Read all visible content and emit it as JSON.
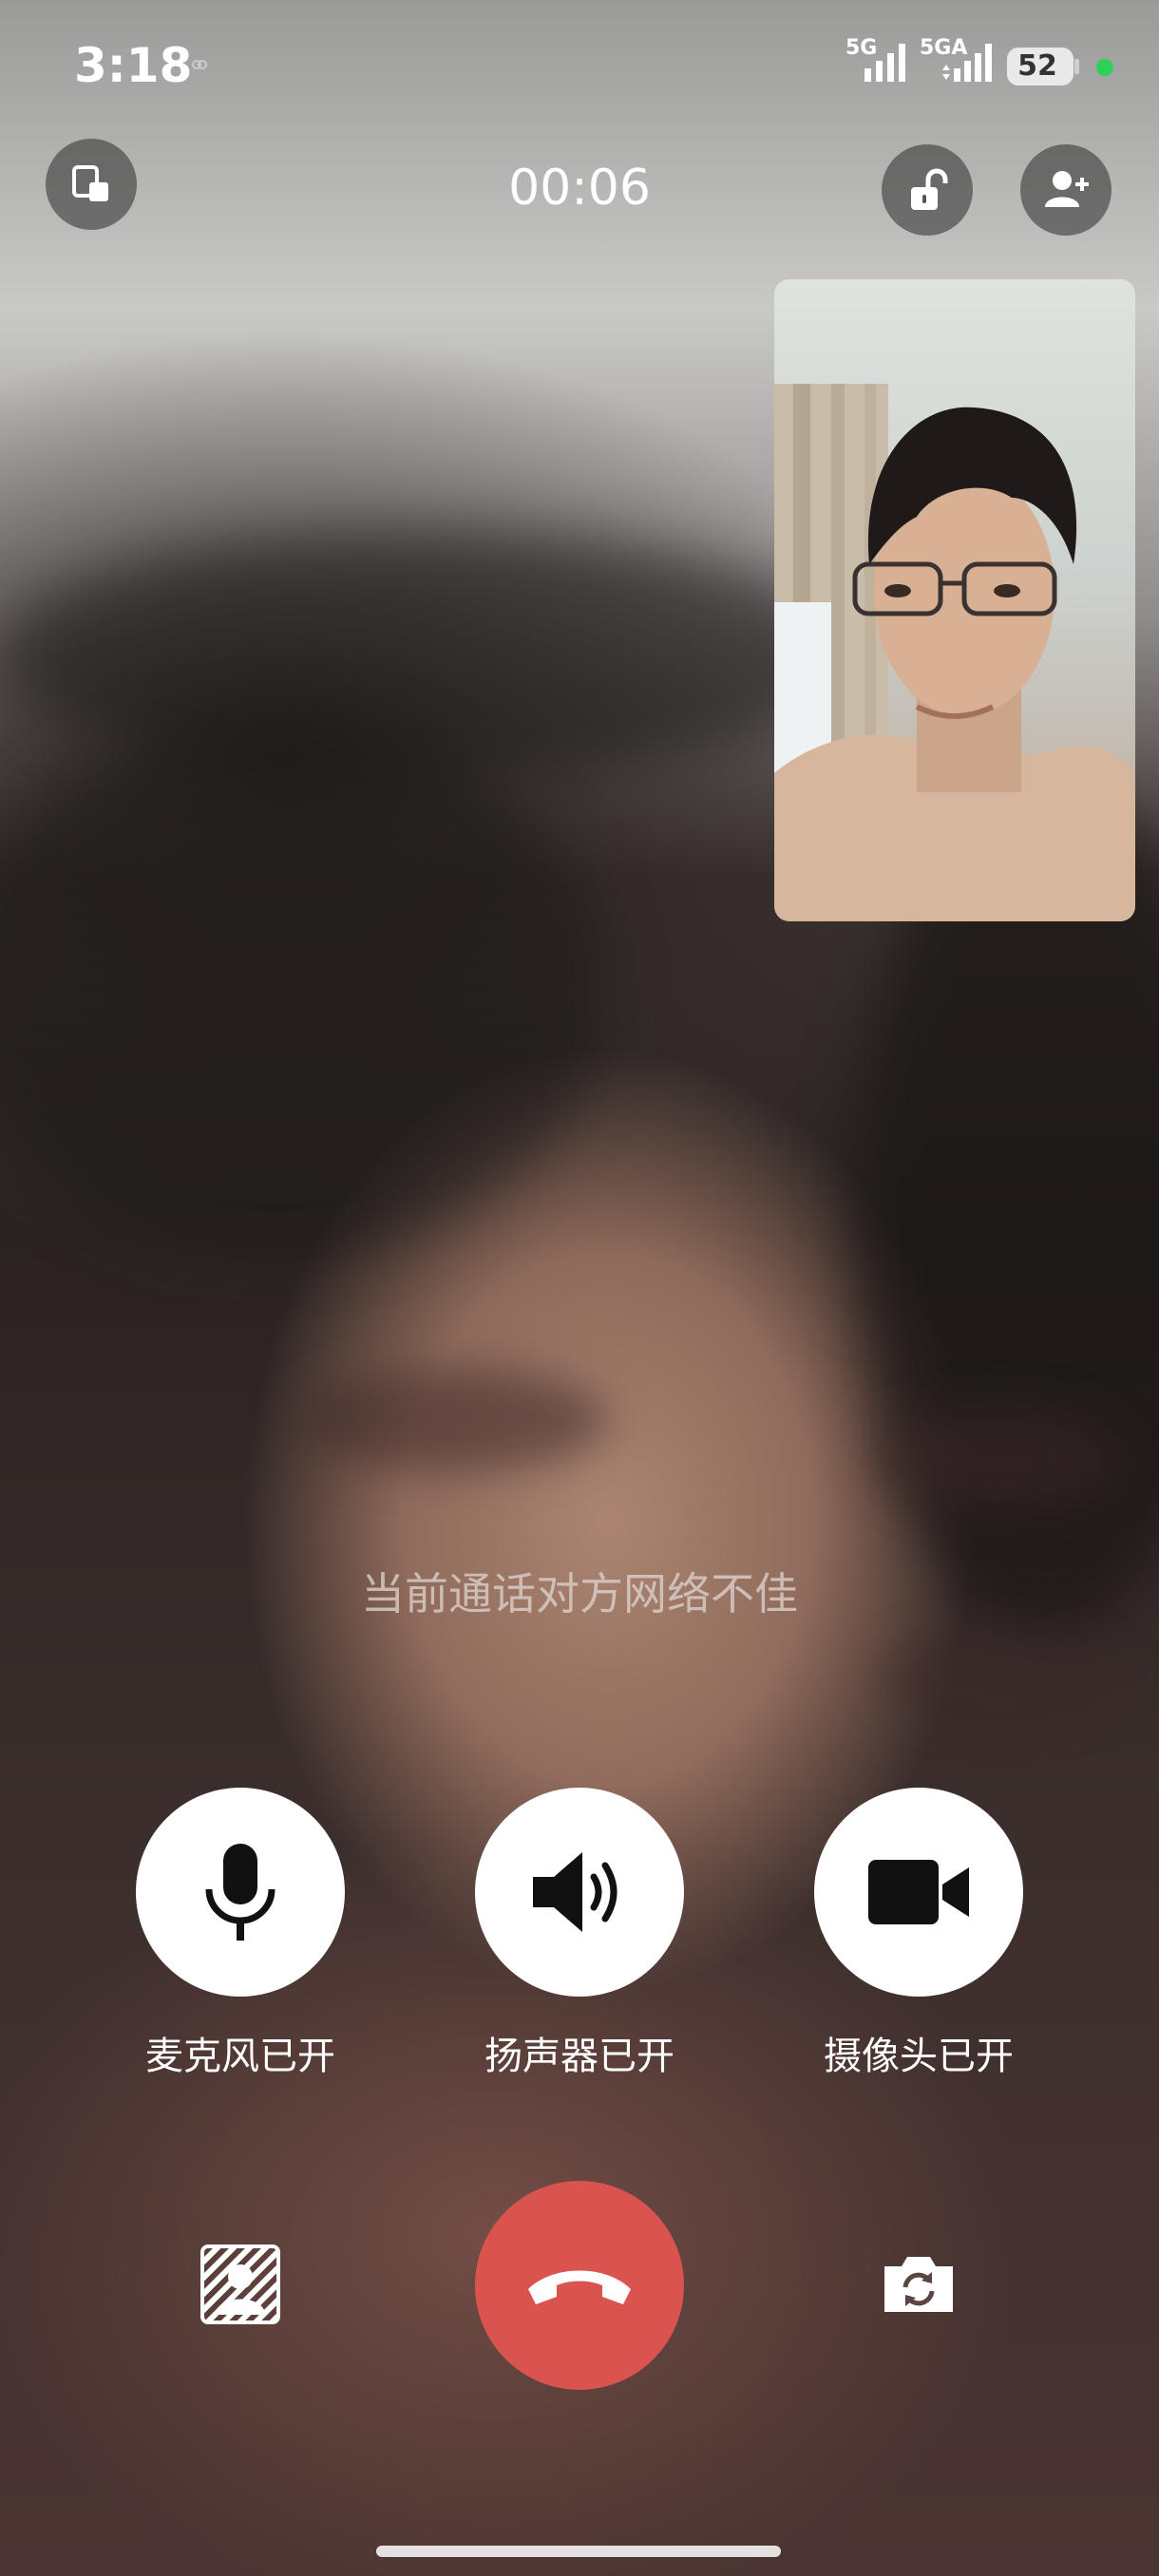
{
  "status_bar": {
    "time": "3:18",
    "signal_1_label": "5G",
    "signal_2_label": "5GA",
    "battery": "52",
    "dot_color": "#2ed158"
  },
  "header": {
    "duration": "00:06",
    "left_icon": "minimize-window-icon",
    "lock_icon": "unlock-icon",
    "add_icon": "add-person-icon"
  },
  "notice": "当前通话对方网络不佳",
  "controls": [
    {
      "label": "麦克风已开",
      "icon": "microphone-icon"
    },
    {
      "label": "扬声器已开",
      "icon": "speaker-icon"
    },
    {
      "label": "摄像头已开",
      "icon": "video-camera-icon"
    }
  ],
  "bottom": {
    "left_icon": "background-blur-icon",
    "center_icon": "hang-up-icon",
    "right_icon": "switch-camera-icon",
    "hangup_color": "#d9534f"
  }
}
